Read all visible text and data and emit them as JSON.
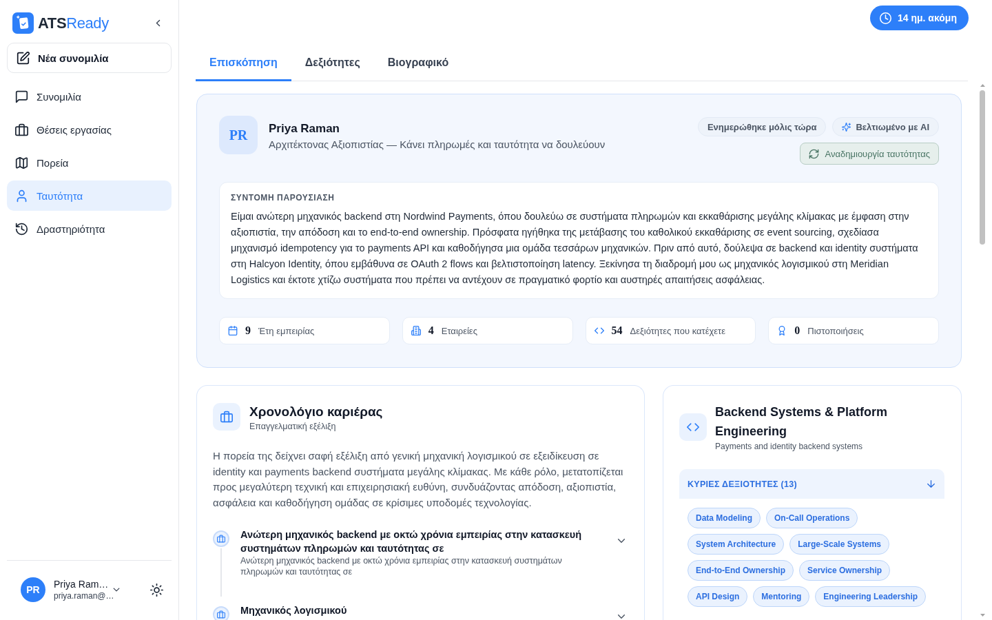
{
  "sidebar": {
    "logo": {
      "prefix": "ATS",
      "suffix": "Ready"
    },
    "new_chat": "Νέα συνομιλία",
    "items": [
      {
        "label": "Συνομιλία",
        "selected": false
      },
      {
        "label": "Θέσεις εργασίας",
        "selected": false
      },
      {
        "label": "Πορεία",
        "selected": false
      },
      {
        "label": "Ταυτότητα",
        "selected": true
      },
      {
        "label": "Δραστηριότητα",
        "selected": false
      }
    ],
    "user": {
      "initials": "PR",
      "name": "Priya Ram…",
      "email": "priya.raman@…"
    }
  },
  "trial": {
    "label": "14 ημ. ακόμη"
  },
  "tabs": [
    {
      "label": "Επισκόπηση",
      "selected": true
    },
    {
      "label": "Δεξιότητες",
      "selected": false
    },
    {
      "label": "Βιογραφικό",
      "selected": false
    }
  ],
  "profile": {
    "initials": "PR",
    "name": "Priya Raman",
    "headline": "Αρχιτέκτονας Αξιοπιστίας — Κάνει πληρωμές και ταυτότητα να δουλεύουν",
    "badges": [
      {
        "label": "Ενημερώθηκε μόλις τώρα",
        "kind": "status"
      },
      {
        "label": "Βελτιωμένο με AI",
        "kind": "ai"
      }
    ],
    "regenerate": "Αναδημιουργία ταυτότητας",
    "summary": {
      "heading": "ΣΥΝΤΟΜΗ ΠΑΡΟΥΣΙΑΣΗ",
      "text": "Είμαι ανώτερη μηχανικός backend στη Nordwind Payments, όπου δουλεύω σε συστήματα πληρωμών και εκκαθάρισης μεγάλης κλίμακας με έμφαση στην αξιοπιστία, την απόδοση και το end-to-end ownership. Πρόσφατα ηγήθηκα της μετάβασης του καθολικού εκκαθάρισης σε event sourcing, σχεδίασα μηχανισμό idempotency για το payments API και καθοδήγησα μια ομάδα τεσσάρων μηχανικών. Πριν από αυτό, δούλεψα σε backend και identity συστήματα στη Halcyon Identity, όπου εμβάθυνα σε OAuth 2 flows και βελτιστοποίηση latency. Ξεκίνησα τη διαδρομή μου ως μηχανικός λογισμικού στη Meridian Logistics και έκτοτε χτίζω συστήματα που πρέπει να αντέχουν σε πραγματικό φορτίο και αυστηρές απαιτήσεις ασφάλειας."
    },
    "stats": [
      {
        "value": "9",
        "label": "Έτη εμπειρίας"
      },
      {
        "value": "4",
        "label": "Εταιρείες"
      },
      {
        "value": "54",
        "label": "Δεξιότητες που κατέχετε"
      },
      {
        "value": "0",
        "label": "Πιστοποιήσεις"
      }
    ]
  },
  "career_timeline": {
    "title": "Χρονολόγιο καριέρας",
    "subtitle": "Επαγγελματική εξέλιξη",
    "text": "Η πορεία της δείχνει σαφή εξέλιξη από γενική μηχανική λογισμικού σε εξειδίκευση σε identity και payments backend συστήματα μεγάλης κλίμακας. Με κάθε ρόλο, μετατοπίζεται προς μεγαλύτερη τεχνική και επιχειρησιακή ευθύνη, συνδυάζοντας απόδοση, αξιοπιστία, ασφάλεια και καθοδήγηση ομάδας σε κρίσιμες υποδομές τεχνολογίας.",
    "entries": [
      {
        "title": "Ανώτερη μηχανικός backend με οκτώ χρόνια εμπειρίας στην κατασκευή συστημάτων πληρωμών και ταυτότητας σε",
        "subtitle": "Ανώτερη μηχανικός backend με οκτώ χρόνια εμπειρίας στην κατασκευή συστημάτων πληρωμών και ταυτότητας σε"
      },
      {
        "title": "Μηχανικός λογισμικού"
      }
    ]
  },
  "skill_group": {
    "title": "Backend Systems & Platform Engineering",
    "subtitle": "Payments and identity backend systems",
    "section": {
      "label": "ΚΥΡΙΕΣ ΔΕΞΙΟΤΗΤΕΣ (13)"
    },
    "tags": [
      "Data Modeling",
      "On-Call Operations",
      "System Architecture",
      "Large-Scale Systems",
      "End-to-End Ownership",
      "Service Ownership",
      "API Design",
      "Mentoring",
      "Engineering Leadership"
    ]
  }
}
